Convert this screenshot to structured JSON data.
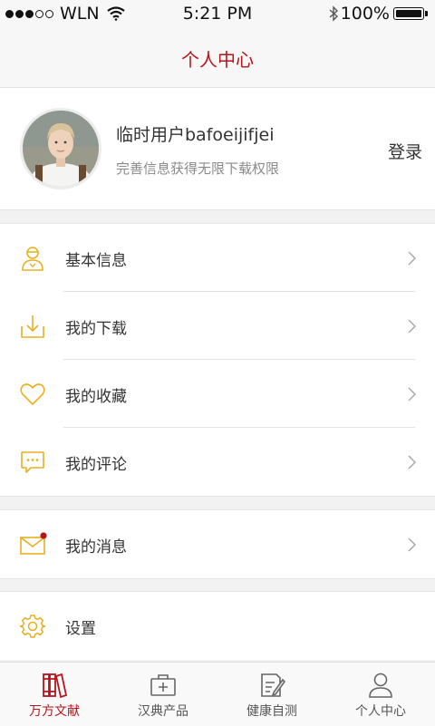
{
  "status_bar": {
    "carrier": "WLN",
    "time": "5:21 PM",
    "battery": "100%"
  },
  "nav": {
    "title": "个人中心"
  },
  "profile": {
    "name": "临时用户bafoeijifjei",
    "subtitle": "完善信息获得无限下载权限",
    "login_label": "登录"
  },
  "menu_group_1": [
    {
      "label": "基本信息",
      "icon": "user-info-icon"
    },
    {
      "label": "我的下载",
      "icon": "download-icon"
    },
    {
      "label": "我的收藏",
      "icon": "heart-icon"
    },
    {
      "label": "我的评论",
      "icon": "comment-icon"
    }
  ],
  "menu_group_2": [
    {
      "label": "我的消息",
      "icon": "mail-icon",
      "unread": true
    }
  ],
  "menu_group_3": [
    {
      "label": "设置",
      "icon": "gear-icon"
    }
  ],
  "tabs": [
    {
      "label": "万方文献",
      "icon": "books-icon",
      "active": true
    },
    {
      "label": "汉典产品",
      "icon": "medical-kit-icon",
      "active": false
    },
    {
      "label": "健康自测",
      "icon": "edit-icon",
      "active": false
    },
    {
      "label": "个人中心",
      "icon": "person-icon",
      "active": false
    }
  ],
  "colors": {
    "accent": "#b8141c",
    "icon_gold": "#e8b020",
    "background": "#f2f2f2"
  }
}
